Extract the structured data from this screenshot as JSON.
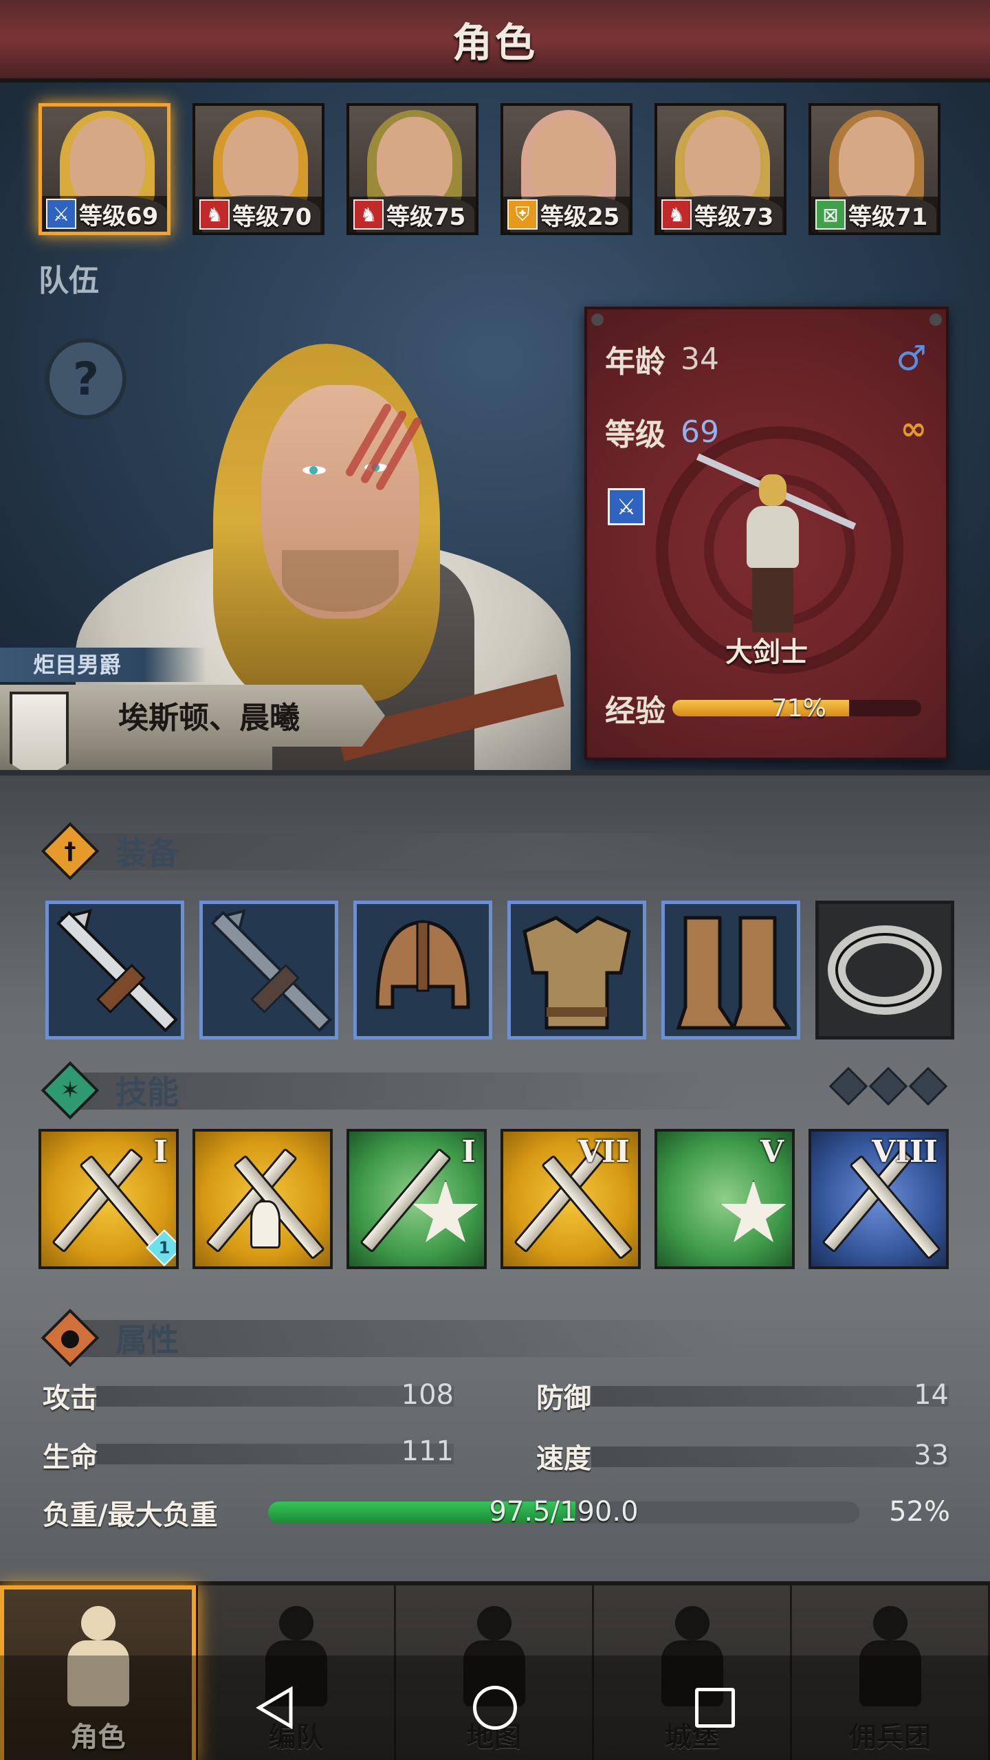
{
  "header": {
    "title": "角色"
  },
  "roster": [
    {
      "level": "等级69",
      "class_icon": "sword-icon",
      "class_color": "#2f63c2",
      "hair": "#d7ac3a",
      "selected": true
    },
    {
      "level": "等级70",
      "class_icon": "bear-icon",
      "class_color": "#c22a2a",
      "hair": "#d59a2a",
      "selected": false
    },
    {
      "level": "等级75",
      "class_icon": "bear-icon",
      "class_color": "#c22a2a",
      "hair": "#9a8a3a",
      "selected": false
    },
    {
      "level": "等级25",
      "class_icon": "shield-icon",
      "class_color": "#e79a1a",
      "hair": "#d8a690",
      "selected": false
    },
    {
      "level": "等级73",
      "class_icon": "bear-icon",
      "class_color": "#c22a2a",
      "hair": "#c9a44a",
      "selected": false
    },
    {
      "level": "等级71",
      "class_icon": "crossed-box-icon",
      "class_color": "#3fa24a",
      "hair": "#b07a3a",
      "selected": false
    }
  ],
  "team_label": "队伍",
  "hero": {
    "title": "炬目男爵",
    "name": "埃斯顿、晨曦"
  },
  "info": {
    "age_label": "年龄",
    "age": "34",
    "gender_icon": "male-icon",
    "level_label": "等级",
    "level": "69",
    "class_name": "大剑士",
    "exp_label": "经验",
    "exp_percent": "71%",
    "exp_value": 71
  },
  "equipment": {
    "title": "装备",
    "slots": [
      "sword-icon",
      "sword-icon",
      "helmet-icon",
      "armor-icon",
      "boots-icon",
      "ring-icon"
    ]
  },
  "skills": {
    "title": "技能",
    "items": [
      {
        "tier": "I",
        "color": "gold",
        "badge": "1"
      },
      {
        "tier": "",
        "color": "gold",
        "badge": ""
      },
      {
        "tier": "I",
        "color": "green",
        "badge": ""
      },
      {
        "tier": "VII",
        "color": "gold",
        "badge": ""
      },
      {
        "tier": "V",
        "color": "green",
        "badge": ""
      },
      {
        "tier": "VIII",
        "color": "blue",
        "badge": ""
      }
    ]
  },
  "attributes": {
    "title": "属性",
    "attack_label": "攻击",
    "attack": "108",
    "defense_label": "防御",
    "defense": "14",
    "health_label": "生命",
    "health": "111",
    "speed_label": "速度",
    "speed": "33",
    "load_label": "负重/最大负重",
    "load_text": "97.5/190.0",
    "load_percent": "52%",
    "load_value": 52
  },
  "nav": [
    {
      "label": "角色",
      "icon": "knight-icon",
      "active": true
    },
    {
      "label": "编队",
      "icon": "helmet-icon",
      "active": false
    },
    {
      "label": "地图",
      "icon": "compass-icon",
      "active": false
    },
    {
      "label": "城堡",
      "icon": "castle-icon",
      "active": false
    },
    {
      "label": "佣兵团",
      "icon": "banner-icon",
      "active": false
    }
  ]
}
